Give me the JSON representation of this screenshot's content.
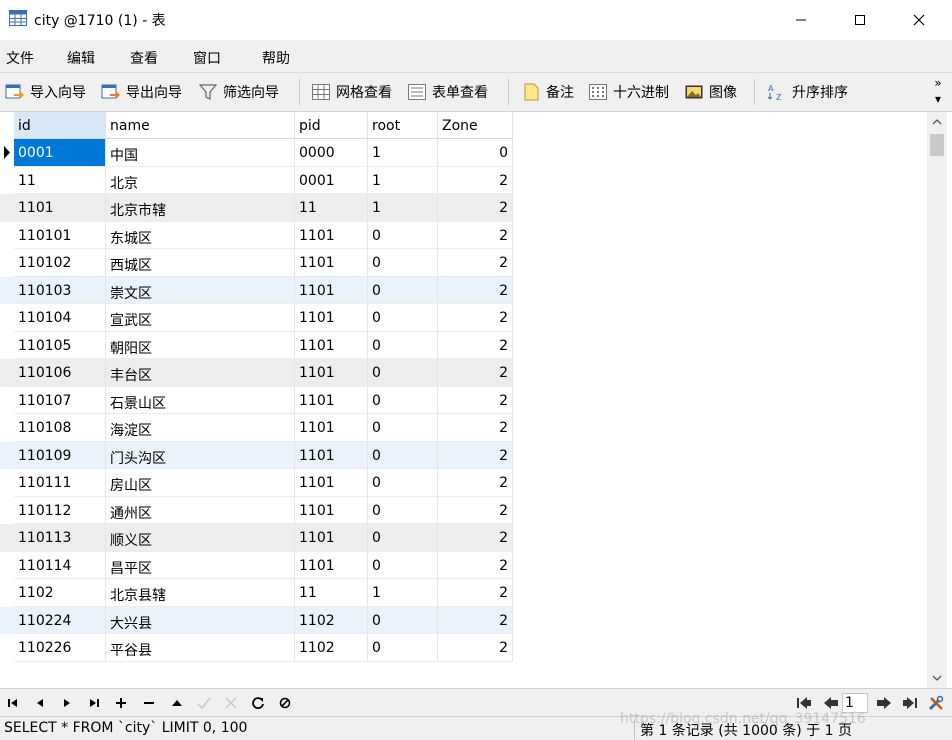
{
  "window": {
    "title": "city @1710 (1) - 表"
  },
  "menu": {
    "items": [
      "文件",
      "编辑",
      "查看",
      "窗口",
      "帮助"
    ]
  },
  "toolbar": {
    "import_label": "导入向导",
    "export_label": "导出向导",
    "filter_label": "筛选向导",
    "grid_view_label": "网格查看",
    "form_view_label": "表单查看",
    "memo_label": "备注",
    "hex_label": "十六进制",
    "image_label": "图像",
    "sort_label": "升序排序",
    "overflow": "»"
  },
  "grid": {
    "columns": [
      "id",
      "name",
      "pid",
      "root",
      "Zone"
    ],
    "rows": [
      [
        "0001",
        "中国",
        "0000",
        "1",
        "0"
      ],
      [
        "11",
        "北京",
        "0001",
        "1",
        "2"
      ],
      [
        "1101",
        "北京市辖",
        "11",
        "1",
        "2"
      ],
      [
        "110101",
        "东城区",
        "1101",
        "0",
        "2"
      ],
      [
        "110102",
        "西城区",
        "1101",
        "0",
        "2"
      ],
      [
        "110103",
        "崇文区",
        "1101",
        "0",
        "2"
      ],
      [
        "110104",
        "宣武区",
        "1101",
        "0",
        "2"
      ],
      [
        "110105",
        "朝阳区",
        "1101",
        "0",
        "2"
      ],
      [
        "110106",
        "丰台区",
        "1101",
        "0",
        "2"
      ],
      [
        "110107",
        "石景山区",
        "1101",
        "0",
        "2"
      ],
      [
        "110108",
        "海淀区",
        "1101",
        "0",
        "2"
      ],
      [
        "110109",
        "门头沟区",
        "1101",
        "0",
        "2"
      ],
      [
        "110111",
        "房山区",
        "1101",
        "0",
        "2"
      ],
      [
        "110112",
        "通州区",
        "1101",
        "0",
        "2"
      ],
      [
        "110113",
        "顺义区",
        "1101",
        "0",
        "2"
      ],
      [
        "110114",
        "昌平区",
        "1101",
        "0",
        "2"
      ],
      [
        "1102",
        "北京县辖",
        "11",
        "1",
        "2"
      ],
      [
        "110224",
        "大兴县",
        "1102",
        "0",
        "2"
      ],
      [
        "110226",
        "平谷县",
        "1102",
        "0",
        "2"
      ]
    ],
    "row_tints": [
      "",
      "",
      "gray",
      "",
      "",
      "blue",
      "",
      "",
      "gray",
      "",
      "",
      "blue",
      "",
      "",
      "gray",
      "",
      "",
      "blue",
      ""
    ]
  },
  "navbar": {
    "page_value": "1"
  },
  "status": {
    "sql": "SELECT * FROM `city` LIMIT 0, 100",
    "record": "第 1 条记录 (共 1000 条) 于 1 页",
    "watermark": "https://blog.csdn.net/qq_39147516"
  },
  "colors": {
    "selection": "#0078d7",
    "header_selected": "#d9e8f6",
    "row_gray": "#ededed",
    "row_blue": "#eaf2fb"
  }
}
